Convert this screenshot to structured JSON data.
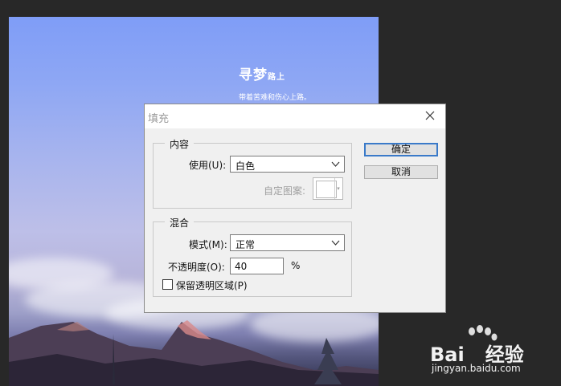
{
  "poster": {
    "title_big": "寻梦",
    "title_small": "路上",
    "subtitle": "带着苦难和伤心上路。"
  },
  "dialog": {
    "title": "填充",
    "content_group": {
      "legend": "内容",
      "use_label": "使用(U):",
      "use_value": "白色",
      "custom_pattern_label": "自定图案:"
    },
    "blend_group": {
      "legend": "混合",
      "mode_label": "模式(M):",
      "mode_value": "正常",
      "opacity_label": "不透明度(O):",
      "opacity_value": "40",
      "opacity_unit": "%",
      "preserve_label": "保留透明区域(P)",
      "preserve_checked": false
    },
    "ok_label": "确定",
    "cancel_label": "取消"
  },
  "watermark": {
    "brand": "Bai",
    "brand2": "经验",
    "url": "jingyan.baidu.com"
  },
  "colors": {
    "workspace": "#282828",
    "default_button_border": "#3a7ac9"
  }
}
